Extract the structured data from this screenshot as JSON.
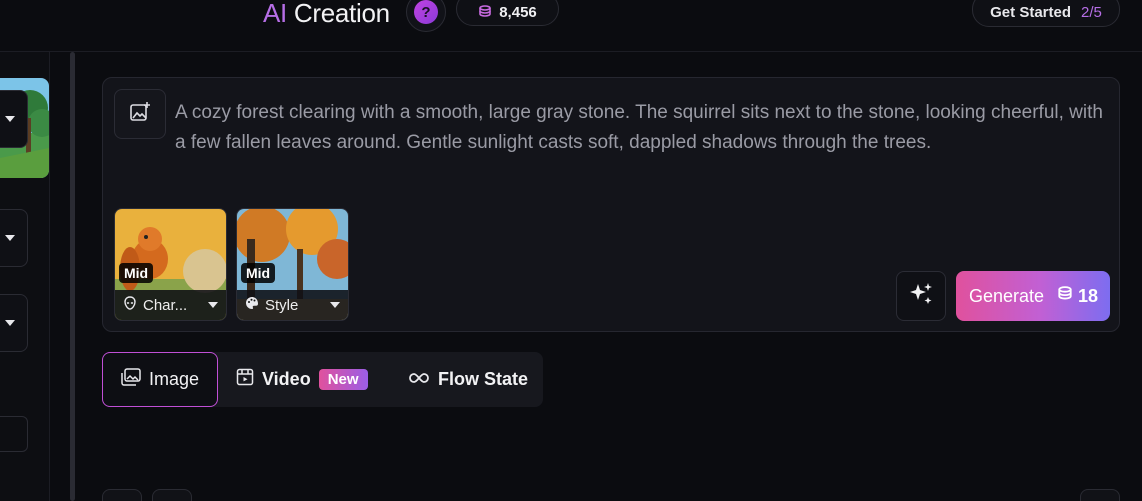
{
  "header": {
    "title_ai": "AI",
    "title_rest": " Creation",
    "help_label": "?",
    "credits": "8,456",
    "get_started_label": "Get Started",
    "get_started_progress": "2/5"
  },
  "prompt": {
    "text": "A cozy forest clearing with a smooth, large gray stone. The squirrel sits next to the stone, looking cheerful, with a few fallen leaves around. Gentle sunlight casts soft, dappled shadows through the trees."
  },
  "references": [
    {
      "badge": "Mid",
      "label": "Char...",
      "icon": "alien-icon"
    },
    {
      "badge": "Mid",
      "label": "Style",
      "icon": "palette-icon"
    }
  ],
  "generate": {
    "label": "Generate",
    "cost": "18"
  },
  "modes": {
    "image": "Image",
    "video": "Video",
    "video_badge": "New",
    "flow": "Flow State"
  },
  "colors": {
    "accent_purple": "#b66ee6",
    "generate_start": "#e0519d",
    "generate_end": "#7d6df0",
    "background": "#0b0c10"
  }
}
